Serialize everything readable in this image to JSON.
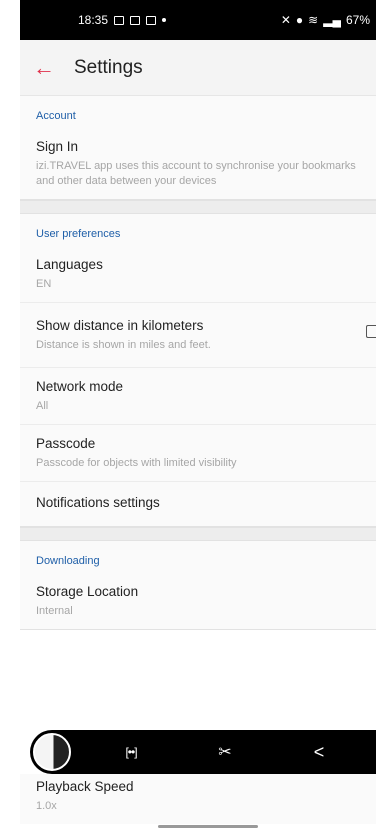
{
  "status_bar": {
    "time": "18:35",
    "battery": "67%"
  },
  "app_bar": {
    "title": "Settings"
  },
  "sections": {
    "account": {
      "header": "Account",
      "sign_in": {
        "title": "Sign In",
        "subtitle": "izi.TRAVEL app uses this account to synchronise your bookmarks and other data between your devices"
      }
    },
    "user_preferences": {
      "header": "User preferences",
      "languages": {
        "title": "Languages",
        "value": "EN"
      },
      "distance": {
        "title": "Show distance in kilometers",
        "subtitle": "Distance is shown in miles and feet.",
        "checked": false
      },
      "network_mode": {
        "title": "Network mode",
        "value": "All"
      },
      "passcode": {
        "title": "Passcode",
        "subtitle": "Passcode for objects with limited visibility"
      },
      "notifications": {
        "title": "Notifications settings"
      }
    },
    "downloading": {
      "header": "Downloading",
      "storage": {
        "title": "Storage Location",
        "value": "Internal"
      }
    },
    "playback": {
      "title": "Playback Speed",
      "value": "1.0x"
    }
  },
  "icons": {
    "back": "arrow-left-icon",
    "scan": "scan-text-icon",
    "crop": "crop-edit-icon",
    "share": "share-icon"
  },
  "colors": {
    "accent": "#e0314b",
    "section_header": "#1f5fa8"
  }
}
